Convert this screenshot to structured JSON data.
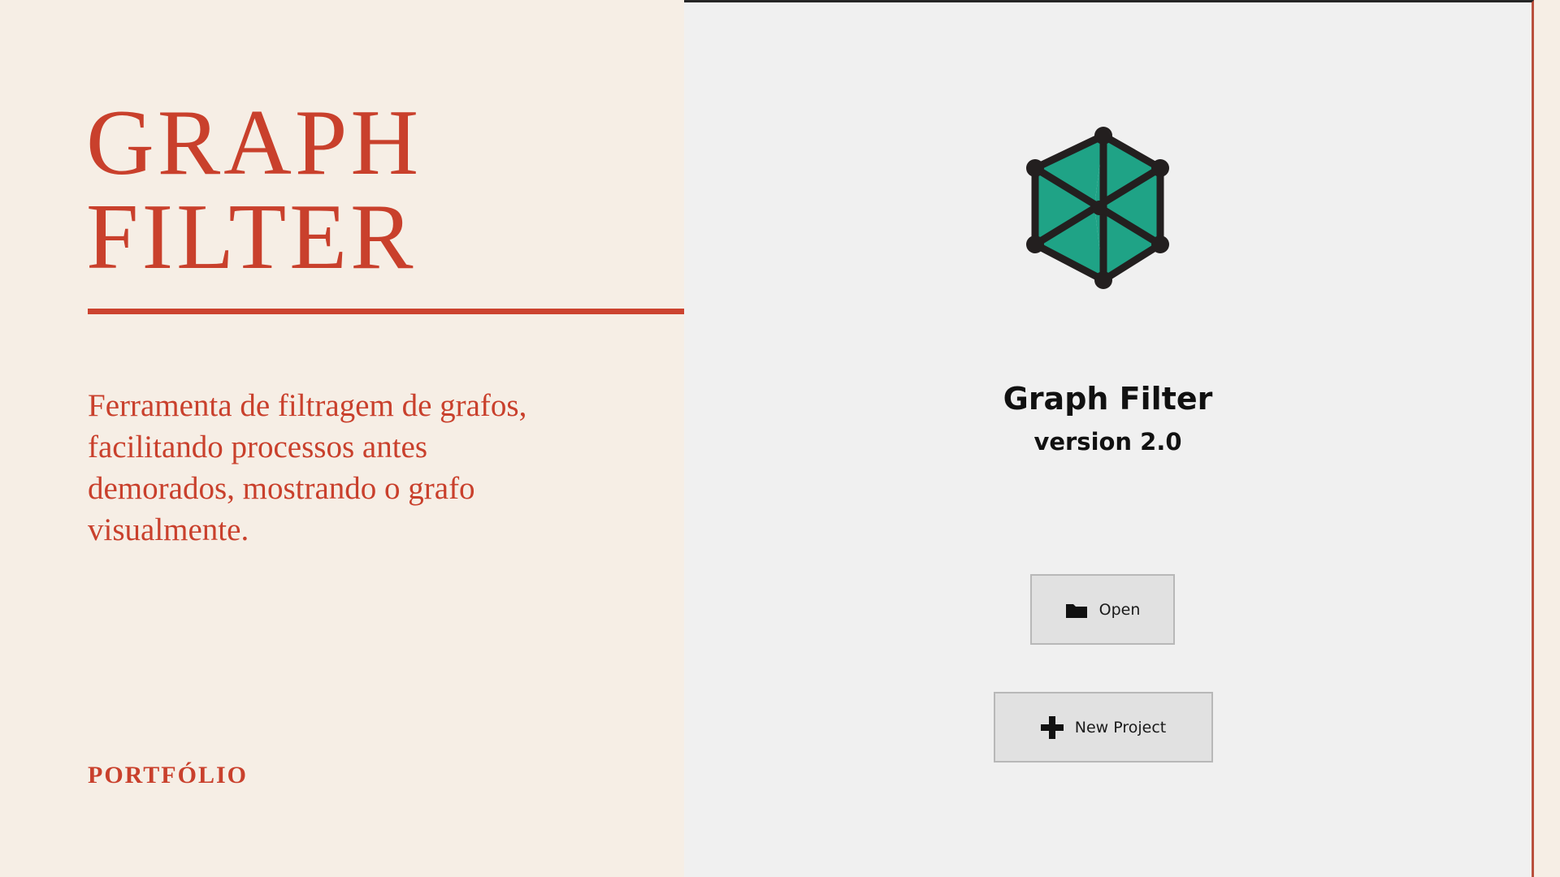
{
  "slide": {
    "title_line1": "GRAPH",
    "title_line2": "FILTER",
    "description": "Ferramenta de filtragem de grafos, facilitando processos antes demorados, mostrando o grafo visualmente.",
    "footer_label": "PORTFÓLIO",
    "accent_color": "#c9402c",
    "background_color": "#f6eee5"
  },
  "app": {
    "name": "Graph Filter",
    "version": "version 2.0",
    "logo_icon": "hexagon-graph-icon",
    "logo_color": "#1fa386",
    "buttons": {
      "open_label": "Open",
      "open_icon": "folder-icon",
      "new_project_label": "New Project",
      "new_project_icon": "plus-icon"
    }
  }
}
